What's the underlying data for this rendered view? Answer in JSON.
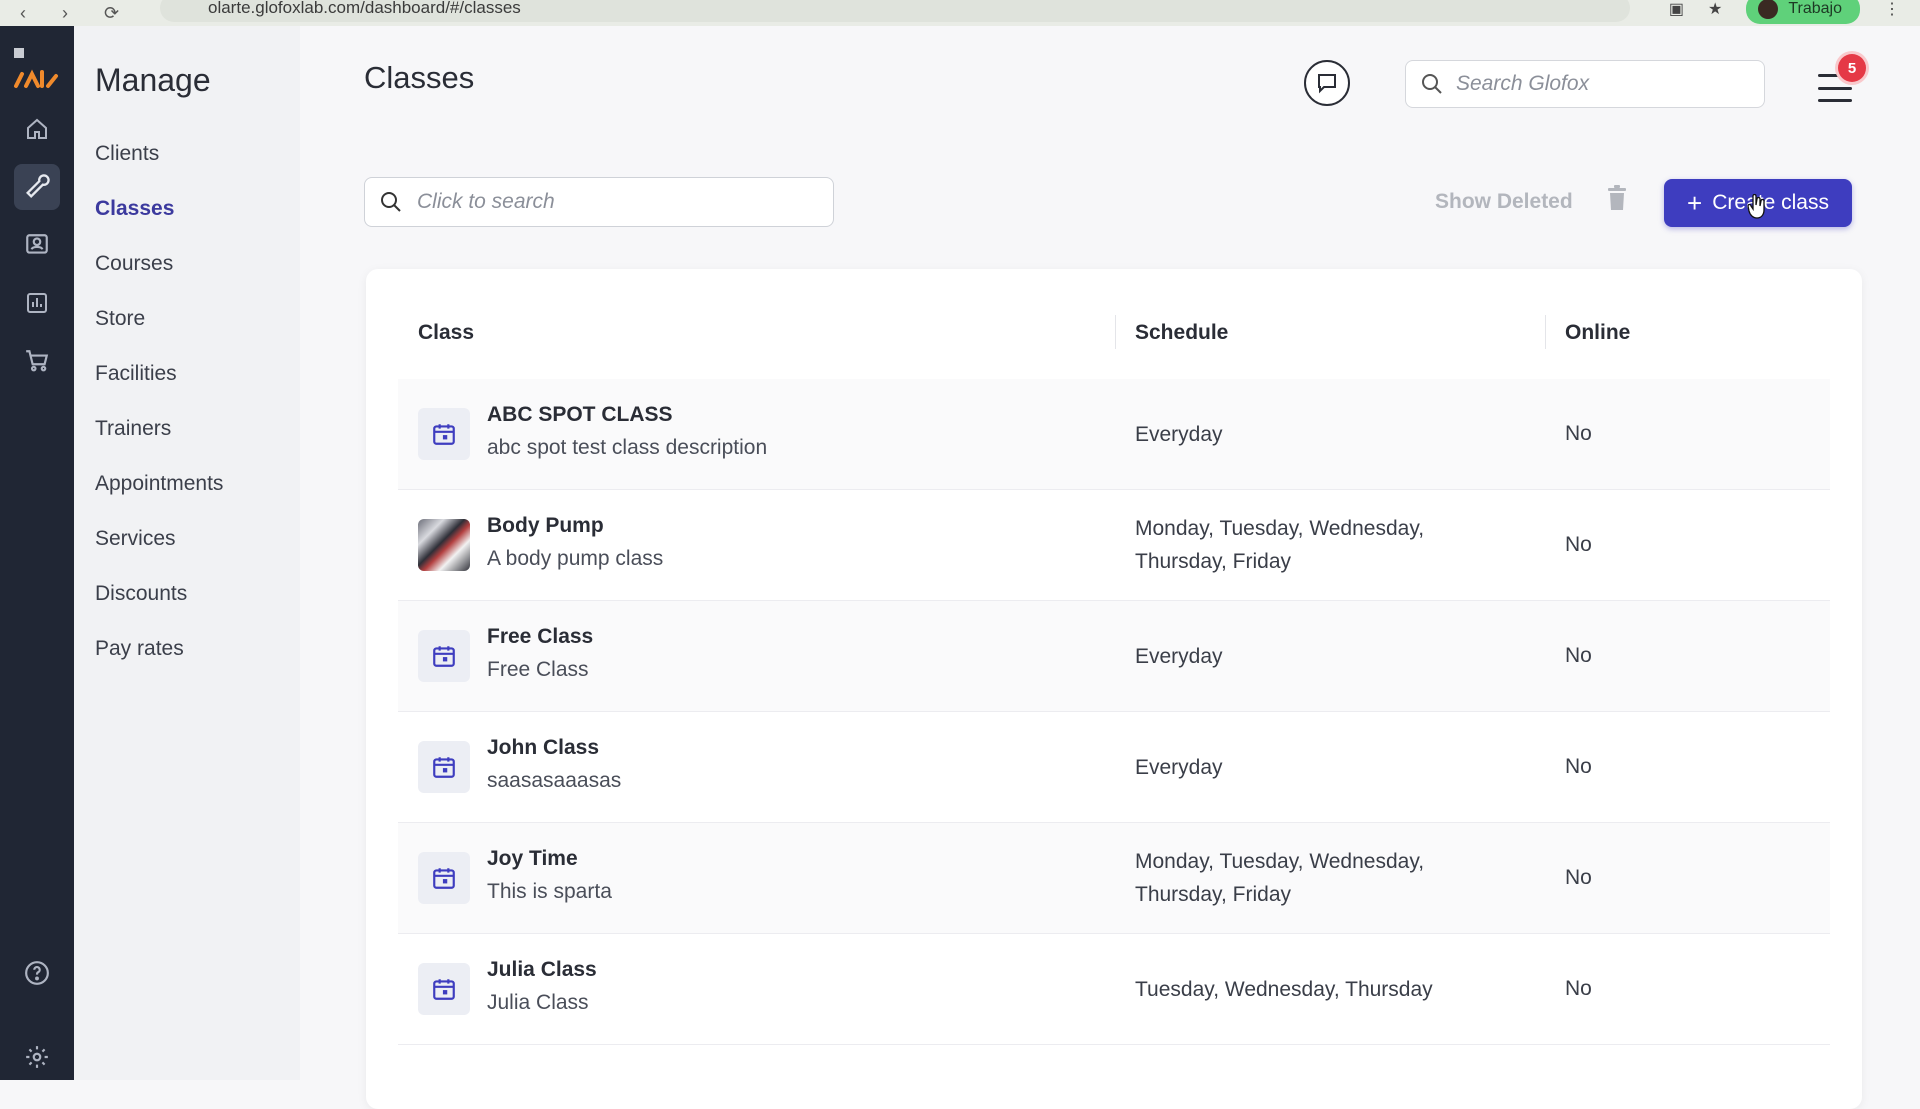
{
  "browser": {
    "url": "olarte.glofoxlab.com/dashboard/#/classes",
    "profile_label": "Trabajo"
  },
  "rail": {
    "icons": [
      "logo-icon",
      "home-icon",
      "wrench-icon",
      "contact-card-icon",
      "bar-chart-icon",
      "cart-icon",
      "help-icon",
      "gear-icon"
    ],
    "active": "wrench-icon"
  },
  "sidebar": {
    "title": "Manage",
    "items": [
      {
        "label": "Clients"
      },
      {
        "label": "Classes",
        "active": true
      },
      {
        "label": "Courses"
      },
      {
        "label": "Store"
      },
      {
        "label": "Facilities"
      },
      {
        "label": "Trainers"
      },
      {
        "label": "Appointments"
      },
      {
        "label": "Services"
      },
      {
        "label": "Discounts"
      },
      {
        "label": "Pay rates"
      }
    ]
  },
  "header": {
    "title": "Classes",
    "search_placeholder": "Search Glofox",
    "notification_count": "5"
  },
  "toolbar": {
    "search_placeholder": "Click to search",
    "show_deleted_label": "Show Deleted",
    "create_label": "Create class"
  },
  "table": {
    "columns": [
      "Class",
      "Schedule",
      "Online"
    ],
    "rows": [
      {
        "name": "ABC SPOT CLASS",
        "description": "abc spot test class description",
        "schedule": "Everyday",
        "online": "No",
        "thumb": "calendar-icon"
      },
      {
        "name": "Body Pump",
        "description": "A body pump class",
        "schedule": "Monday, Tuesday, Wednesday, Thursday, Friday",
        "online": "No",
        "thumb": "photo"
      },
      {
        "name": "Free Class",
        "description": "Free Class",
        "schedule": "Everyday",
        "online": "No",
        "thumb": "calendar-icon"
      },
      {
        "name": "John Class",
        "description": "saasasaaasas",
        "schedule": "Everyday",
        "online": "No",
        "thumb": "calendar-icon"
      },
      {
        "name": "Joy Time",
        "description": "This is sparta",
        "schedule": "Monday, Tuesday, Wednesday, Thursday, Friday",
        "online": "No",
        "thumb": "calendar-icon"
      },
      {
        "name": "Julia Class",
        "description": "Julia Class",
        "schedule": "Tuesday, Wednesday, Thursday",
        "online": "No",
        "thumb": "calendar-icon"
      }
    ]
  },
  "colors": {
    "primary": "#3e3dbf",
    "rail_bg": "#202634",
    "badge": "#e53946"
  }
}
